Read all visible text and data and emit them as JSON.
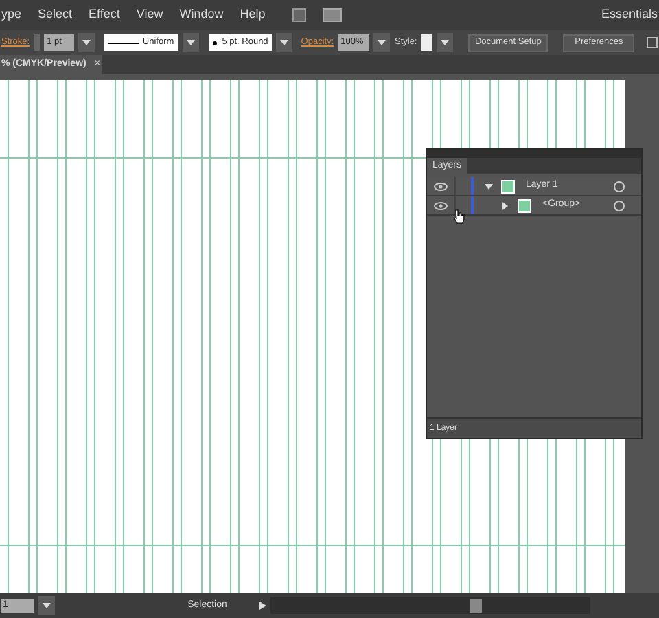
{
  "menu_bar": {
    "items": [
      "ype",
      "Select",
      "Effect",
      "View",
      "Window",
      "Help"
    ],
    "workspace": "Essentials"
  },
  "control_bar": {
    "stroke_label": "Stroke:",
    "stroke_weight": "1 pt",
    "profile": "Uniform",
    "brush": "5 pt. Round",
    "opacity_label": "Opacity:",
    "opacity": "100%",
    "style_label": "Style:",
    "buttons": [
      "Document Setup",
      "Preferences"
    ]
  },
  "document_tab": {
    "title": "% (CMYK/Preview)",
    "close": "×"
  },
  "layers_panel": {
    "title": "Layers",
    "layers": [
      {
        "name": "Layer 1",
        "visible": true,
        "expanded": true,
        "color": "#3b5bdb",
        "children": [
          {
            "name": "<Group>",
            "visible": true,
            "expanded": false,
            "color": "#3b5bdb"
          }
        ]
      }
    ],
    "footer": "1 Layer"
  },
  "status_bar": {
    "zoom": "1",
    "tool": "Selection"
  }
}
